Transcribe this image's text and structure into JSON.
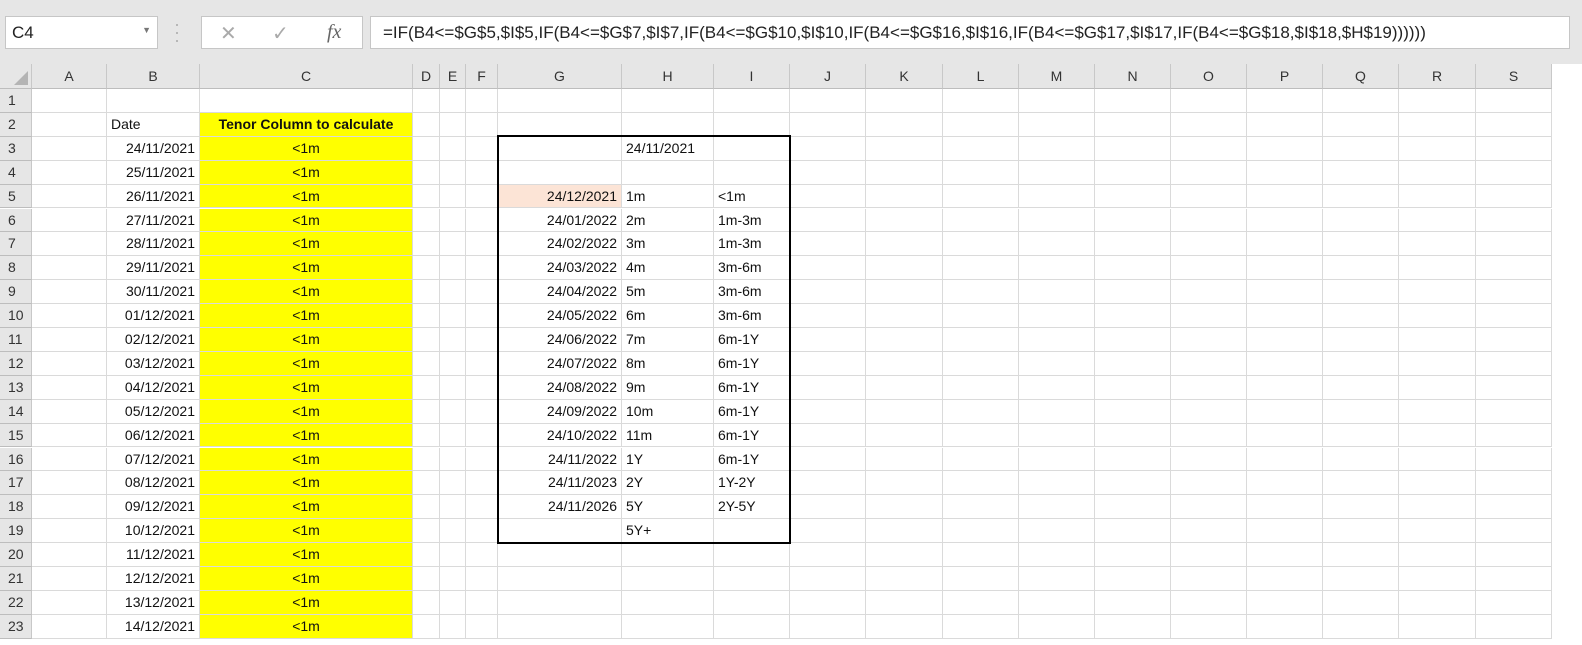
{
  "name_box": "C4",
  "formula": "=IF(B4<=$G$5,$I$5,IF(B4<=$G$7,$I$7,IF(B4<=$G$10,$I$10,IF(B4<=$G$16,$I$16,IF(B4<=$G$17,$I$17,IF(B4<=$G$18,$I$18,$H$19))))))",
  "fx_label": "fx",
  "columns": [
    "A",
    "B",
    "C",
    "D",
    "E",
    "F",
    "G",
    "H",
    "I",
    "J",
    "K",
    "L",
    "M",
    "N",
    "O",
    "P",
    "Q",
    "R",
    "S"
  ],
  "rows": [
    "1",
    "2",
    "3",
    "4",
    "5",
    "6",
    "7",
    "8",
    "9",
    "10",
    "11",
    "12",
    "13",
    "14",
    "15",
    "16",
    "17",
    "18",
    "19",
    "20",
    "21",
    "22",
    "23"
  ],
  "colors": {
    "highlight": "#ffff00",
    "peach": "#fce4d6"
  },
  "b2": "Date",
  "c2": "Tenor Column to calculate",
  "dates": [
    "24/11/2021",
    "25/11/2021",
    "26/11/2021",
    "27/11/2021",
    "28/11/2021",
    "29/11/2021",
    "30/11/2021",
    "01/12/2021",
    "02/12/2021",
    "03/12/2021",
    "04/12/2021",
    "05/12/2021",
    "06/12/2021",
    "07/12/2021",
    "08/12/2021",
    "09/12/2021",
    "10/12/2021",
    "11/12/2021",
    "12/12/2021",
    "13/12/2021",
    "14/12/2021"
  ],
  "tenors": [
    "<1m",
    "<1m",
    "<1m",
    "<1m",
    "<1m",
    "<1m",
    "<1m",
    "<1m",
    "<1m",
    "<1m",
    "<1m",
    "<1m",
    "<1m",
    "<1m",
    "<1m",
    "<1m",
    "<1m",
    "<1m",
    "<1m",
    "<1m",
    "<1m"
  ],
  "h3": "24/11/2021",
  "lookup": [
    {
      "g": "24/12/2021",
      "h": "1m",
      "i": "<1m"
    },
    {
      "g": "24/01/2022",
      "h": "2m",
      "i": "1m-3m"
    },
    {
      "g": "24/02/2022",
      "h": "3m",
      "i": "1m-3m"
    },
    {
      "g": "24/03/2022",
      "h": "4m",
      "i": "3m-6m"
    },
    {
      "g": "24/04/2022",
      "h": "5m",
      "i": "3m-6m"
    },
    {
      "g": "24/05/2022",
      "h": "6m",
      "i": "3m-6m"
    },
    {
      "g": "24/06/2022",
      "h": "7m",
      "i": "6m-1Y"
    },
    {
      "g": "24/07/2022",
      "h": "8m",
      "i": "6m-1Y"
    },
    {
      "g": "24/08/2022",
      "h": "9m",
      "i": "6m-1Y"
    },
    {
      "g": "24/09/2022",
      "h": "10m",
      "i": "6m-1Y"
    },
    {
      "g": "24/10/2022",
      "h": "11m",
      "i": "6m-1Y"
    },
    {
      "g": "24/11/2022",
      "h": "1Y",
      "i": "6m-1Y"
    },
    {
      "g": "24/11/2023",
      "h": "2Y",
      "i": "1Y-2Y"
    },
    {
      "g": "24/11/2026",
      "h": "5Y",
      "i": "2Y-5Y"
    },
    {
      "g": "",
      "h": "5Y+",
      "i": ""
    }
  ]
}
